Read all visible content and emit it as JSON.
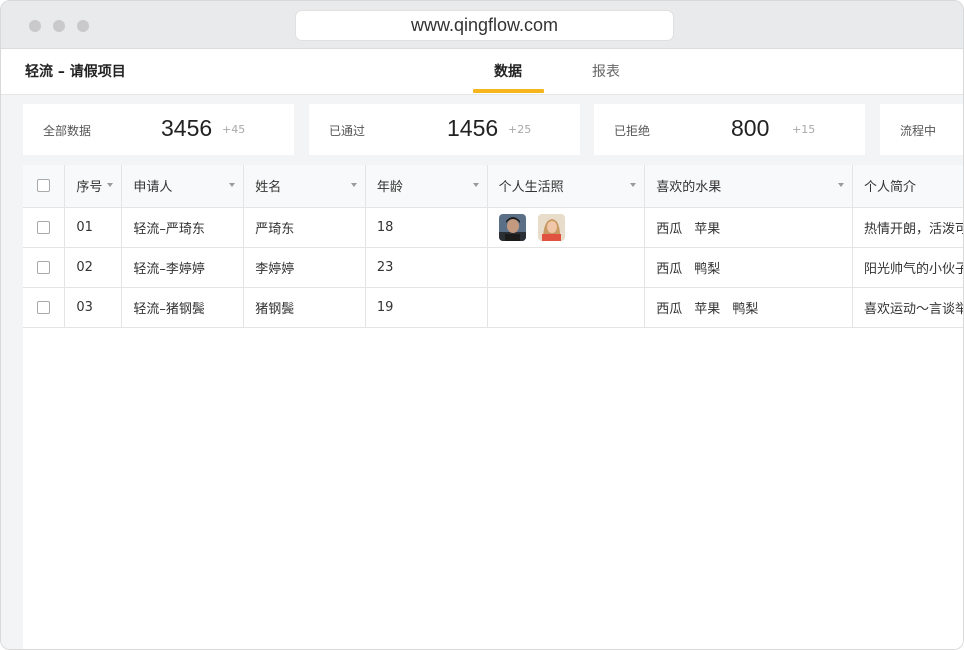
{
  "browser": {
    "url": "www.qingflow.com"
  },
  "app": {
    "title": "轻流 – 请假项目",
    "tabs": [
      {
        "label": "数据",
        "active": true
      },
      {
        "label": "报表",
        "active": false
      }
    ],
    "accent_color": "#f5b51d"
  },
  "stats": [
    {
      "label": "全部数据",
      "value": "3456",
      "delta": "+45"
    },
    {
      "label": "已通过",
      "value": "1456",
      "delta": "+25"
    },
    {
      "label": "已拒绝",
      "value": "800",
      "delta": "+15"
    },
    {
      "label": "流程中"
    }
  ],
  "table": {
    "columns": [
      "序号",
      "申请人",
      "姓名",
      "年龄",
      "个人生活照",
      "喜欢的水果",
      "个人简介"
    ],
    "rows": [
      {
        "no": "01",
        "applicant": "轻流–严琦东",
        "name": "严琦东",
        "age": "18",
        "photos": [
          "photo-man",
          "photo-woman"
        ],
        "fruits": [
          "西瓜",
          "苹果"
        ],
        "bio": "热情开朗，活泼可"
      },
      {
        "no": "02",
        "applicant": "轻流–李婷婷",
        "name": "李婷婷",
        "age": "23",
        "photos": [],
        "fruits": [
          "西瓜",
          "鸭梨"
        ],
        "bio": "阳光帅气的小伙子"
      },
      {
        "no": "03",
        "applicant": "轻流–猪钢鬓",
        "name": "猪钢鬓",
        "age": "19",
        "photos": [],
        "fruits": [
          "西瓜",
          "苹果",
          "鸭梨"
        ],
        "bio": "喜欢运动～言谈举"
      }
    ]
  }
}
